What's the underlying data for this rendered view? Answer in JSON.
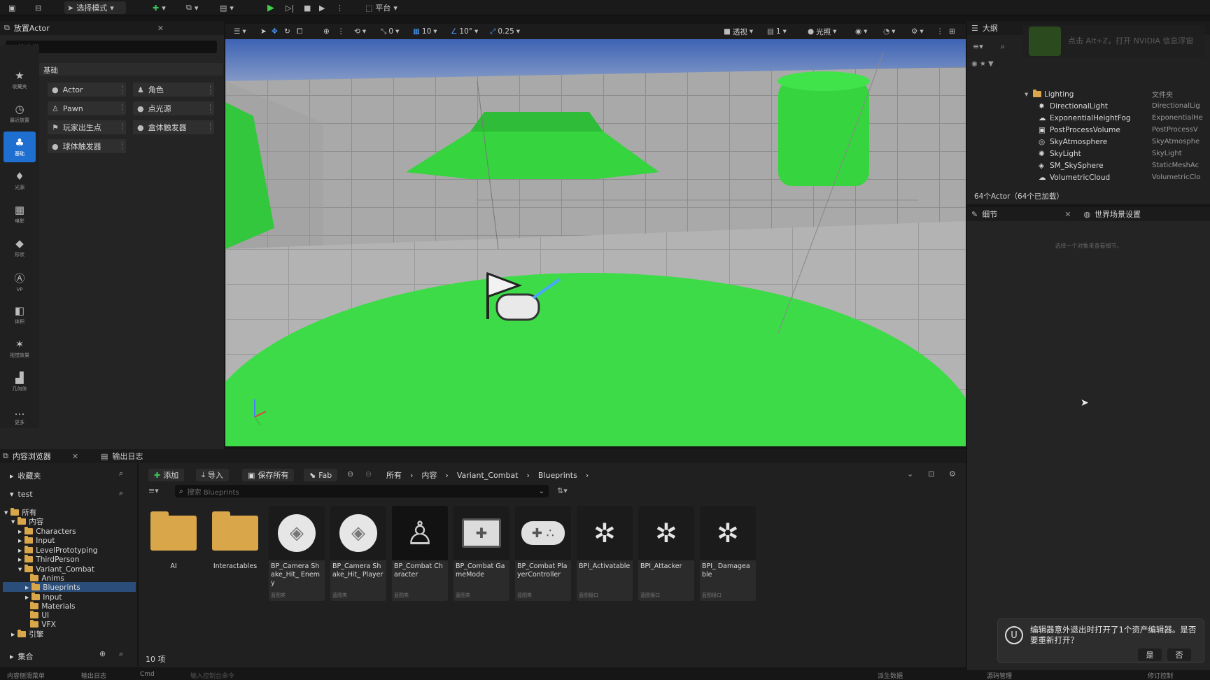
{
  "toolbar": {
    "mode_label": "选择模式",
    "platform_label": "平台"
  },
  "place_actors": {
    "tab_title": "放置Actor",
    "search_placeholder": "搜索类",
    "section_title": "基础",
    "categories": [
      "收藏夹",
      "最近放置",
      "基础",
      "光源",
      "电影",
      "形状",
      "VP",
      "体积",
      "视觉效果",
      "几何体",
      "更多"
    ],
    "items": [
      "Actor",
      "角色",
      "Pawn",
      "点光源",
      "玩家出生点",
      "盒体触发器",
      "球体触发器"
    ]
  },
  "viewport": {
    "snap_translate": "0",
    "snap_grid": "10",
    "snap_rotate": "10°",
    "snap_scale": "0.25",
    "view_mode": "透视",
    "lighting_mode": "光照",
    "camera_speed": "1"
  },
  "outliner": {
    "tab_title": "大纲",
    "notice": "点击 Alt+Z，打开 NVIDIA 信息浮窗",
    "folder": "Lighting",
    "folder_type": "文件夹",
    "rows": [
      {
        "name": "DirectionalLight",
        "type": "DirectionalLig"
      },
      {
        "name": "ExponentialHeightFog",
        "type": "ExponentialHe"
      },
      {
        "name": "PostProcessVolume",
        "type": "PostProcessV"
      },
      {
        "name": "SkyAtmosphere",
        "type": "SkyAtmosphe"
      },
      {
        "name": "SkyLight",
        "type": "SkyLight"
      },
      {
        "name": "SM_SkySphere",
        "type": "StaticMeshAc"
      },
      {
        "name": "VolumetricCloud",
        "type": "VolumetricClo"
      }
    ],
    "count": "64个Actor（64个已加载）"
  },
  "details": {
    "tab_details": "细节",
    "tab_world": "世界场景设置",
    "empty_hint": "选择一个对象来查看细节。"
  },
  "content_browser": {
    "tab_title": "内容浏览器",
    "tab_output": "输出日志",
    "favorites": "收藏夹",
    "project": "test",
    "tree": [
      "所有",
      "内容",
      "Characters",
      "Input",
      "LevelPrototyping",
      "ThirdPerson",
      "Variant_Combat",
      "Anims",
      "Blueprints",
      "Input",
      "Materials",
      "UI",
      "VFX",
      "引擎"
    ],
    "collections": "集合",
    "add_label": "添加",
    "import_label": "导入",
    "save_all_label": "保存所有",
    "fab_label": "Fab",
    "path": [
      "所有",
      "内容",
      "Variant_Combat",
      "Blueprints"
    ],
    "search_placeholder": "搜索 Blueprints",
    "assets": [
      {
        "name": "AI",
        "kind": "folder",
        "sub": ""
      },
      {
        "name": "Interactables",
        "kind": "folder",
        "sub": ""
      },
      {
        "name": "BP_Camera Shake_Hit_ Enemy",
        "kind": "shake",
        "sub": "蓝图类"
      },
      {
        "name": "BP_Camera Shake_Hit_ Player",
        "kind": "shake",
        "sub": "蓝图类"
      },
      {
        "name": "BP_Combat Character",
        "kind": "character",
        "sub": "蓝图类"
      },
      {
        "name": "BP_Combat GameMode",
        "kind": "gamemode",
        "sub": "蓝图类"
      },
      {
        "name": "BP_Combat PlayerController",
        "kind": "controller",
        "sub": "蓝图类"
      },
      {
        "name": "BPI_Activatable",
        "kind": "interface",
        "sub": "蓝图接口"
      },
      {
        "name": "BPI_Attacker",
        "kind": "interface",
        "sub": "蓝图接口"
      },
      {
        "name": "BPI_ Damageable",
        "kind": "interface",
        "sub": "蓝图接口"
      }
    ],
    "item_count": "10 项"
  },
  "toast": {
    "message": "编辑器意外退出时打开了1个资产编辑器。是否要重新打开？",
    "yes": "是",
    "no": "否"
  },
  "statusbar": {
    "items": [
      "内容侧滑菜单",
      "输出日志",
      "Cmd",
      "输入控制台命令",
      "派生数据",
      "源码管理",
      "修订控制"
    ]
  },
  "colors": {
    "accent": "#1e6fd0",
    "green_mesh": "#33d63f",
    "sky": "#3f66b8"
  }
}
